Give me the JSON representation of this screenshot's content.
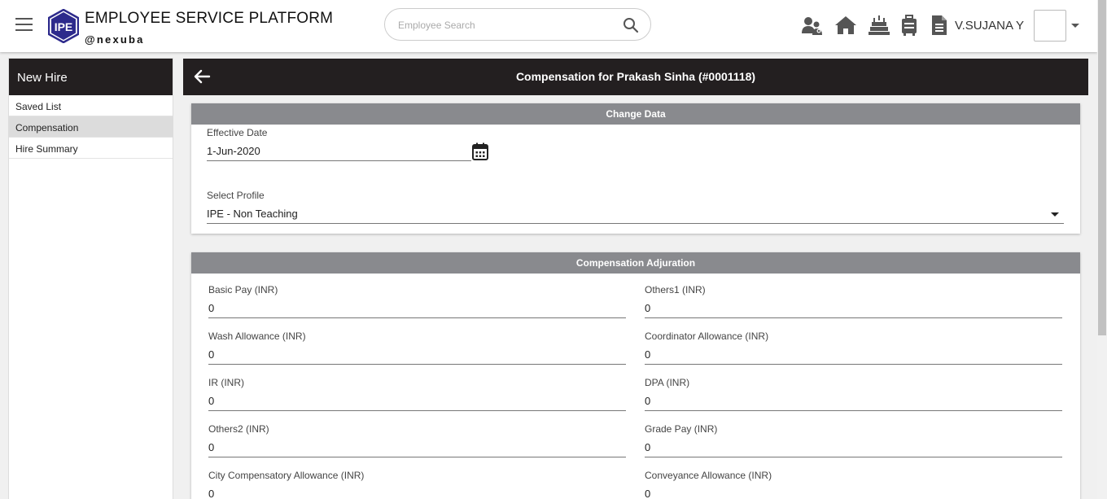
{
  "header": {
    "brand_title": "EMPLOYEE SERVICE PLATFORM",
    "brand_subtitle": "@nexuba",
    "logo_text": "IPE",
    "search_placeholder": "Employee Search",
    "user_name": "V.SUJANA Y",
    "icons": [
      "team-icon",
      "home-icon",
      "birthday-cake-icon",
      "luggage-icon",
      "document-icon"
    ]
  },
  "sidebar": {
    "title": "New Hire",
    "items": [
      {
        "label": "Saved List",
        "active": false
      },
      {
        "label": "Compensation",
        "active": true
      },
      {
        "label": "Hire Summary",
        "active": false
      }
    ]
  },
  "main": {
    "title": "Compensation for Prakash Sinha (#0001118)"
  },
  "change_data": {
    "header": "Change Data",
    "effective_date_label": "Effective Date",
    "effective_date_value": "1-Jun-2020",
    "profile_label": "Select Profile",
    "profile_value": "IPE - Non Teaching"
  },
  "compensation": {
    "header": "Compensation Adjuration",
    "fields": [
      {
        "label": "Basic Pay (INR)",
        "value": "0"
      },
      {
        "label": "Others1 (INR)",
        "value": "0"
      },
      {
        "label": "Wash Allowance (INR)",
        "value": "0"
      },
      {
        "label": "Coordinator Allowance (INR)",
        "value": "0"
      },
      {
        "label": "IR (INR)",
        "value": "0"
      },
      {
        "label": "DPA (INR)",
        "value": "0"
      },
      {
        "label": "Others2 (INR)",
        "value": "0"
      },
      {
        "label": "Grade Pay (INR)",
        "value": "0"
      },
      {
        "label": "City Compensatory Allowance (INR)",
        "value": "0"
      },
      {
        "label": "Conveyance Allowance (INR)",
        "value": "0"
      }
    ]
  },
  "colors": {
    "dark_header": "#231f20",
    "section_header": "#898a8e",
    "logo_blue": "#2d2a8c"
  }
}
